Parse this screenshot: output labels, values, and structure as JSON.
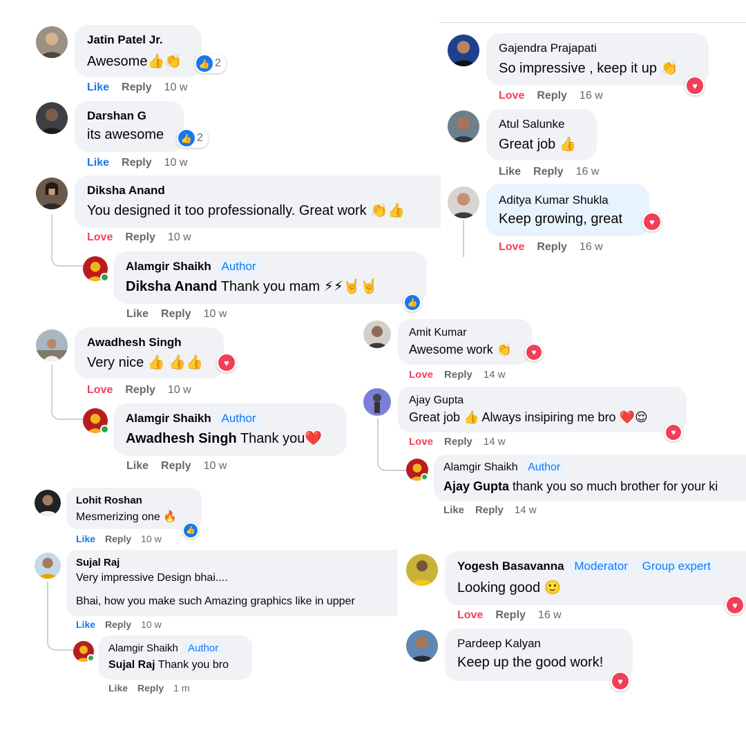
{
  "comments": {
    "jatin": {
      "name": "Jatin Patel Jr.",
      "text": "Awesome",
      "emoji": "👍👏",
      "reaction_count": "2",
      "like": "Like",
      "reply": "Reply",
      "time": "10 w"
    },
    "darshan": {
      "name": "Darshan G",
      "text": "its awesome",
      "reaction_count": "2",
      "like": "Like",
      "reply": "Reply",
      "time": "10 w"
    },
    "diksha": {
      "name": "Diksha Anand",
      "text": "You designed it too professionally. Great work",
      "emoji": "👏👍",
      "love": "Love",
      "reply": "Reply",
      "time": "10 w"
    },
    "reply_diksha": {
      "name": "Alamgir Shaikh",
      "badge": "Author",
      "mention": "Diksha Anand",
      "text": "Thank you mam",
      "emoji": "⚡⚡🤘🤘",
      "like": "Like",
      "reply": "Reply",
      "time": "10 w"
    },
    "awadhesh": {
      "name": "Awadhesh Singh",
      "text": "Very nice",
      "emoji": "👍 👍👍",
      "love": "Love",
      "reply": "Reply",
      "time": "10 w"
    },
    "reply_awadhesh": {
      "name": "Alamgir Shaikh",
      "badge": "Author",
      "mention": "Awadhesh Singh",
      "text": "Thank you",
      "emoji": "❤️",
      "like": "Like",
      "reply": "Reply",
      "time": "10 w"
    },
    "lohit": {
      "name": "Lohit Roshan",
      "text": "Mesmerizing one",
      "emoji": "🔥",
      "like": "Like",
      "reply": "Reply",
      "time": "10 w"
    },
    "sujal": {
      "name": "Sujal Raj",
      "text": "Very impressive Design bhai....",
      "text2": "Bhai, how you make such Amazing graphics like in upper",
      "like": "Like",
      "reply": "Reply",
      "time": "10 w"
    },
    "reply_sujal": {
      "name": "Alamgir Shaikh",
      "badge": "Author",
      "mention": "Sujal Raj",
      "text": "Thank you bro",
      "like": "Like",
      "reply": "Reply",
      "time": "1 m"
    },
    "gajendra": {
      "name": "Gajendra Prajapati",
      "text": "So impressive , keep it up",
      "emoji": "👏",
      "love": "Love",
      "reply": "Reply",
      "time": "16 w"
    },
    "atul": {
      "name": "Atul Salunke",
      "text": "Great job",
      "emoji": "👍",
      "like": "Like",
      "reply": "Reply",
      "time": "16 w"
    },
    "aditya": {
      "name": "Aditya Kumar Shukla",
      "text": "Keep growing, great",
      "love": "Love",
      "reply": "Reply",
      "time": "16 w"
    },
    "amit": {
      "name": "Amit Kumar",
      "text": "Awesome work",
      "emoji": "👏",
      "love": "Love",
      "reply": "Reply",
      "time": "14 w"
    },
    "ajay": {
      "name": "Ajay Gupta",
      "text": "Great job",
      "emoji": "👍",
      "text2": "Always insipiring me bro",
      "emoji2": "❤️😌",
      "love": "Love",
      "reply": "Reply",
      "time": "14 w"
    },
    "reply_ajay": {
      "name": "Alamgir Shaikh",
      "badge": "Author",
      "mention": "Ajay Gupta",
      "text": "thank you so much brother for your ki",
      "like": "Like",
      "reply": "Reply",
      "time": "14 w"
    },
    "yogesh": {
      "name": "Yogesh Basavanna",
      "badge": "Moderator",
      "badge2": "Group expert",
      "text": "Looking good",
      "emoji": "🙂",
      "love": "Love",
      "reply": "Reply",
      "time": "16 w"
    },
    "pardeep": {
      "name": "Pardeep Kalyan",
      "text": "Keep up the good work!"
    }
  },
  "colors": {
    "like_blue": "#1877f2",
    "love_red": "#f33e58",
    "bubble_gray": "#f0f2f5",
    "meta_gray": "#65676b"
  },
  "icons": {
    "like": "thumbs-up-icon",
    "love": "heart-icon"
  }
}
